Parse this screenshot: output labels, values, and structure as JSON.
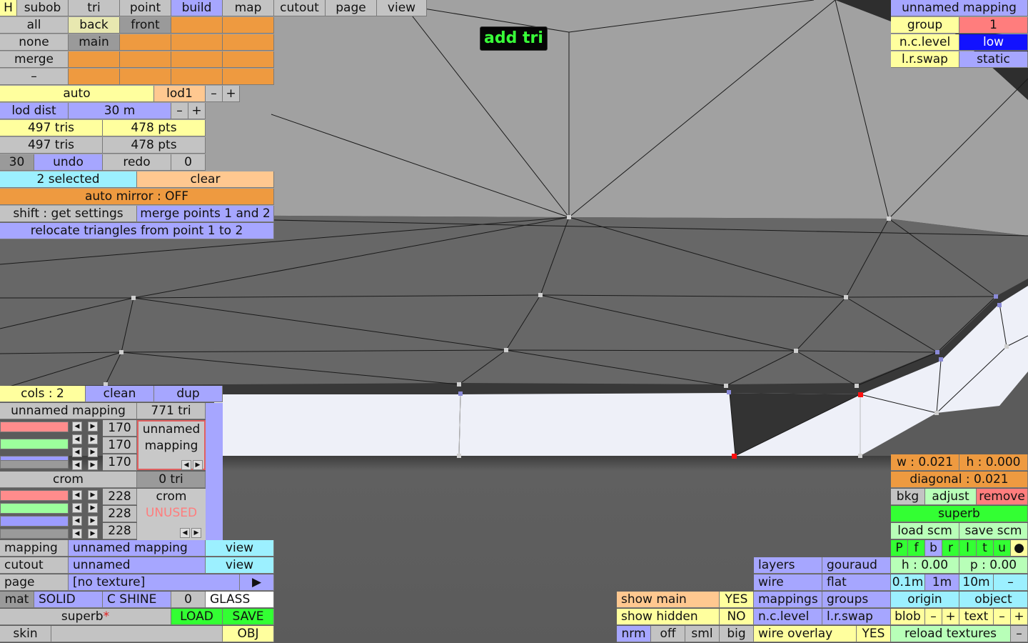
{
  "viewport": {
    "label": "3D mesh viewport",
    "overlay_label": "add tri"
  },
  "top_menu": [
    "H",
    "subob",
    "tri",
    "point",
    "build",
    "map",
    "cutout",
    "page",
    "view"
  ],
  "select": {
    "all": "all",
    "none": "none",
    "merge": "merge",
    "dash": "–",
    "back": "back",
    "front": "front",
    "main": "main"
  },
  "lod": {
    "auto": "auto",
    "lod1": "lod1",
    "minus": "–",
    "plus": "+",
    "dist_label": "lod dist",
    "dist_value": "30 m"
  },
  "stats": {
    "tris1": "497 tris",
    "pts1": "478 pts",
    "tris2": "497 tris",
    "pts2": "478 pts"
  },
  "history": {
    "count": "30",
    "undo": "undo",
    "redo": "redo",
    "zero": "0"
  },
  "selection": {
    "selected": "2 selected",
    "clear": "clear",
    "auto_mirror": "auto mirror : OFF",
    "shift_settings": "shift : get settings",
    "merge_points": "merge points 1 and 2",
    "relocate": "relocate triangles from point 1 to 2"
  },
  "top_right": {
    "title": "unnamed mapping",
    "group_label": "group",
    "group_value": "1",
    "ncl_label": "n.c.level",
    "ncl_value": "low",
    "lr_label": "l.r.swap",
    "lr_value": "static"
  },
  "cols": {
    "cols": "cols : 2",
    "clean": "clean",
    "dup": "dup"
  },
  "mapping1": {
    "name": "unnamed mapping",
    "tri": "771 tri",
    "r": "170",
    "g": "170",
    "b": "170",
    "preview_line1": "unnamed",
    "preview_line2": "mapping"
  },
  "mapping2": {
    "name": "crom",
    "tri": "0 tri",
    "r": "228",
    "g": "228",
    "b": "228",
    "preview_line1": "crom",
    "preview_line2": "UNUSED"
  },
  "props": {
    "mapping_label": "mapping",
    "mapping_value": "unnamed mapping",
    "mapping_view": "view",
    "cutout_label": "cutout",
    "cutout_value": "unnamed",
    "cutout_view": "view",
    "page_label": "page",
    "page_value": "[no texture]",
    "page_arrow": "▶",
    "mat": "mat",
    "solid": "SOLID",
    "cshine": "C SHINE",
    "zero": "0",
    "glass": "GLASS",
    "superb": "superb",
    "star": "*",
    "load": "LOAD",
    "save": "SAVE",
    "skin": "skin",
    "obj": "OBJ"
  },
  "right_panel": {
    "w": "w : 0.021",
    "h": "h : 0.000",
    "diagonal": "diagonal : 0.021",
    "bkg": "bkg",
    "adjust": "adjust",
    "remove": "remove",
    "superb": "superb",
    "load_scm": "load scm",
    "save_scm": "save scm",
    "flags": [
      "P",
      "f",
      "b",
      "r",
      "l",
      "t",
      "u",
      "●"
    ],
    "h2": "h : 0.00",
    "p2": "p : 0.00",
    "step1": "0.1m",
    "step2": "1m",
    "step3": "10m",
    "minus": "–",
    "origin": "origin",
    "object": "object",
    "blob": "blob",
    "text": "text",
    "plus": "+",
    "reload": "reload textures"
  },
  "display": {
    "layers": "layers",
    "gouraud": "gouraud",
    "wire": "wire",
    "flat": "flat",
    "mappings": "mappings",
    "groups": "groups",
    "ncl": "n.c.level",
    "lrswap": "l.r.swap",
    "wire_overlay": "wire overlay",
    "wo_value": "YES"
  },
  "show": {
    "show_main": "show main",
    "show_main_value": "YES",
    "show_hidden": "show hidden",
    "show_hidden_value": "NO",
    "nrm": "nrm",
    "off": "off",
    "sml": "sml",
    "big": "big"
  },
  "colors": {
    "accent_blue": "#a6a6ff",
    "accent_yellow": "#ffff9e",
    "accent_orange": "#ee9a40",
    "accent_green": "#33ff33"
  }
}
